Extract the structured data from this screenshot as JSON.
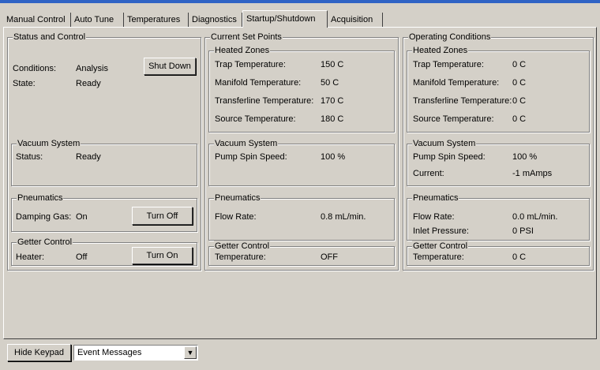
{
  "tabs": [
    "Manual Control",
    "Auto Tune",
    "Temperatures",
    "Diagnostics",
    "Startup/Shutdown",
    "Acquisition"
  ],
  "active_tab": "Startup/Shutdown",
  "status_control": {
    "title": "Status and Control",
    "conditions_label": "Conditions:",
    "conditions_value": "Analysis",
    "state_label": "State:",
    "state_value": "Ready",
    "shutdown_button": "Shut Down",
    "vacuum": {
      "title": "Vacuum System",
      "status_label": "Status:",
      "status_value": "Ready"
    },
    "pneumatics": {
      "title": "Pneumatics",
      "label": "Damping Gas:",
      "value": "On",
      "button": "Turn Off"
    },
    "getter": {
      "title": "Getter Control",
      "label": "Heater:",
      "value": "Off",
      "button": "Turn On"
    }
  },
  "set_points": {
    "title": "Current Set Points",
    "heated": {
      "title": "Heated Zones",
      "rows": [
        {
          "label": "Trap Temperature:",
          "value": "150 C"
        },
        {
          "label": "Manifold Temperature:",
          "value": "50 C"
        },
        {
          "label": "Transferline Temperature:",
          "value": "170 C"
        },
        {
          "label": "Source Temperature:",
          "value": "180 C"
        }
      ]
    },
    "vacuum": {
      "title": "Vacuum System",
      "label": "Pump Spin Speed:",
      "value": "100 %"
    },
    "pneumatics": {
      "title": "Pneumatics",
      "label": "Flow Rate:",
      "value": "0.8 mL/min."
    },
    "getter": {
      "title": "Getter Control",
      "label": "Temperature:",
      "value": "OFF"
    }
  },
  "operating": {
    "title": "Operating Conditions",
    "heated": {
      "title": "Heated Zones",
      "rows": [
        {
          "label": "Trap Temperature:",
          "value": "0 C"
        },
        {
          "label": "Manifold Temperature:",
          "value": "0 C"
        },
        {
          "label": "Transferline Temperature:",
          "value": "0 C"
        },
        {
          "label": "Source Temperature:",
          "value": "0 C"
        }
      ]
    },
    "vacuum": {
      "title": "Vacuum System",
      "pump_label": "Pump Spin Speed:",
      "pump_value": "100 %",
      "current_label": "Current:",
      "current_value": "-1 mAmps"
    },
    "pneumatics": {
      "title": "Pneumatics",
      "flow_label": "Flow Rate:",
      "flow_value": "0.0 mL/min.",
      "inlet_label": "Inlet Pressure:",
      "inlet_value": "0 PSI"
    },
    "getter": {
      "title": "Getter Control",
      "label": "Temperature:",
      "value": "0 C"
    }
  },
  "bottom": {
    "hide_keypad": "Hide Keypad",
    "messages_select": "Event Messages"
  },
  "colors": {
    "face": "#d4d0c8",
    "title_bar": "#2f63c5"
  }
}
